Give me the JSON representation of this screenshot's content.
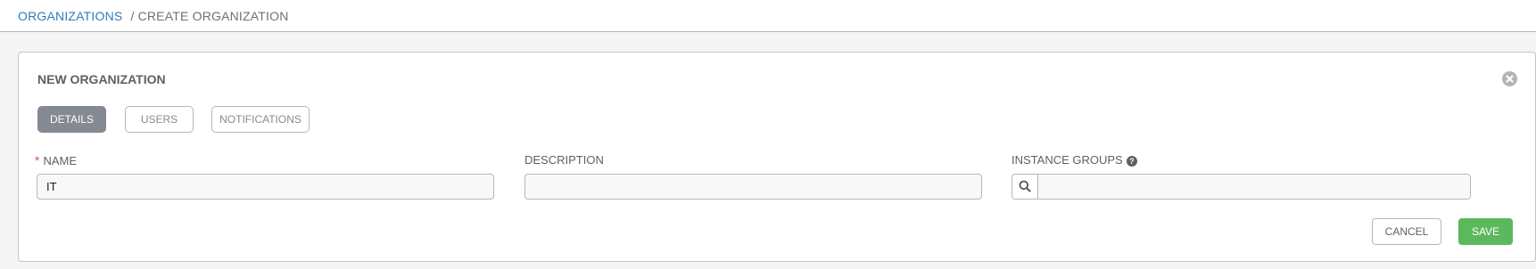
{
  "breadcrumb": {
    "parent": "ORGANIZATIONS",
    "separator": "/",
    "current": "CREATE ORGANIZATION"
  },
  "panel": {
    "title": "NEW ORGANIZATION",
    "close_icon": "close-circle-icon"
  },
  "tabs": [
    {
      "label": "DETAILS",
      "active": true
    },
    {
      "label": "USERS",
      "active": false
    },
    {
      "label": "NOTIFICATIONS",
      "active": false
    }
  ],
  "fields": {
    "name": {
      "label": "NAME",
      "required": true,
      "value": "IT"
    },
    "description": {
      "label": "DESCRIPTION",
      "value": ""
    },
    "instance_groups": {
      "label": "INSTANCE GROUPS",
      "help_icon": "question-circle-icon",
      "lookup_icon": "search-icon",
      "value": ""
    }
  },
  "actions": {
    "cancel_label": "CANCEL",
    "save_label": "SAVE"
  },
  "colors": {
    "link": "#337ab7",
    "active_tab": "#848992",
    "save": "#5cb85c",
    "required": "#d9534f"
  }
}
